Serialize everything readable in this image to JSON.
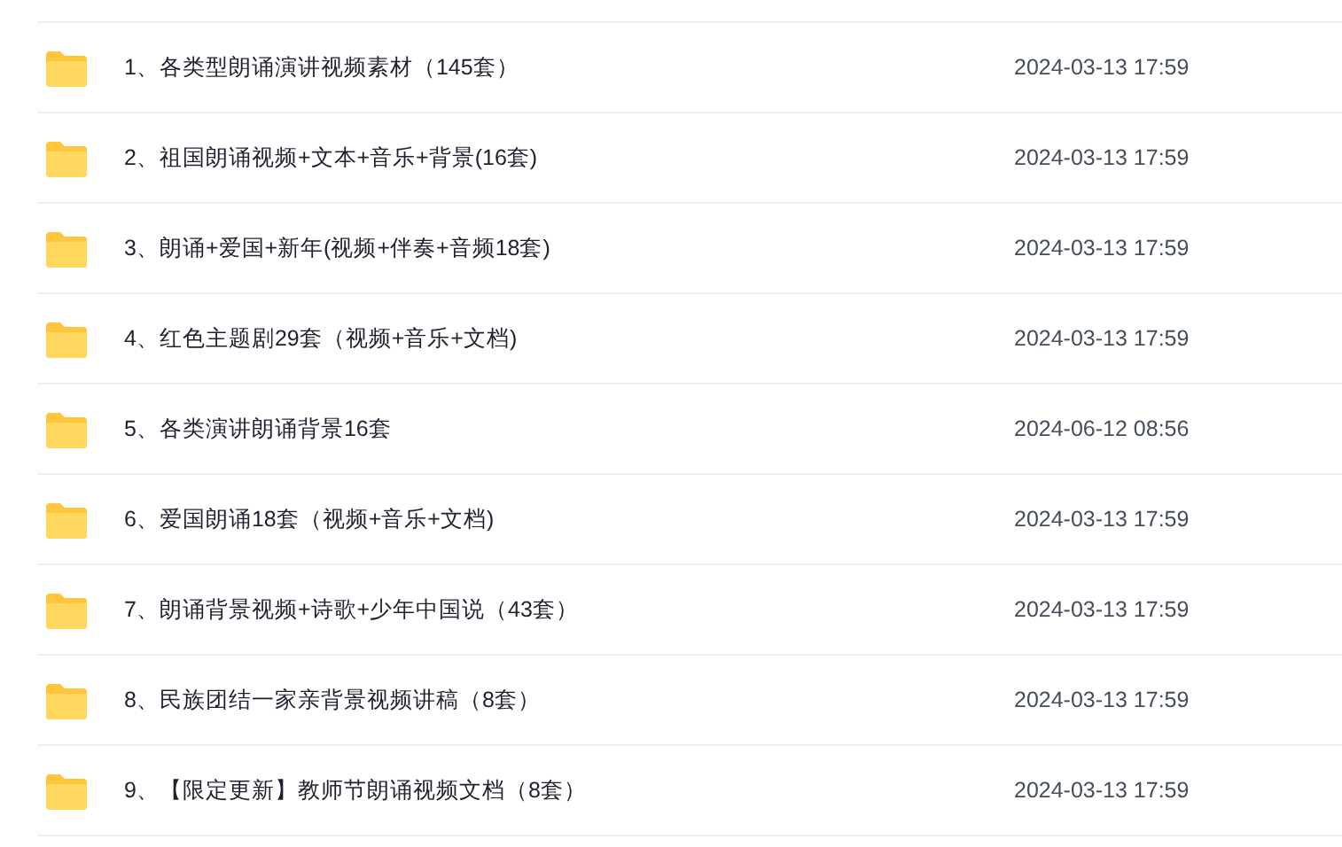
{
  "files": [
    {
      "name": "1、各类型朗诵演讲视频素材（145套）",
      "modified": "2024-03-13 17:59"
    },
    {
      "name": "2、祖国朗诵视频+文本+音乐+背景(16套)",
      "modified": "2024-03-13 17:59"
    },
    {
      "name": "3、朗诵+爱国+新年(视频+伴奏+音频18套)",
      "modified": "2024-03-13 17:59"
    },
    {
      "name": "4、红色主题剧29套（视频+音乐+文档)",
      "modified": "2024-03-13 17:59"
    },
    {
      "name": "5、各类演讲朗诵背景16套",
      "modified": "2024-06-12 08:56"
    },
    {
      "name": "6、爱国朗诵18套（视频+音乐+文档)",
      "modified": "2024-03-13 17:59"
    },
    {
      "name": "7、朗诵背景视频+诗歌+少年中国说（43套）",
      "modified": "2024-03-13 17:59"
    },
    {
      "name": "8、民族团结一家亲背景视频讲稿（8套）",
      "modified": "2024-03-13 17:59"
    },
    {
      "name": "9、【限定更新】教师节朗诵视频文档（8套）",
      "modified": "2024-03-13 17:59"
    }
  ]
}
